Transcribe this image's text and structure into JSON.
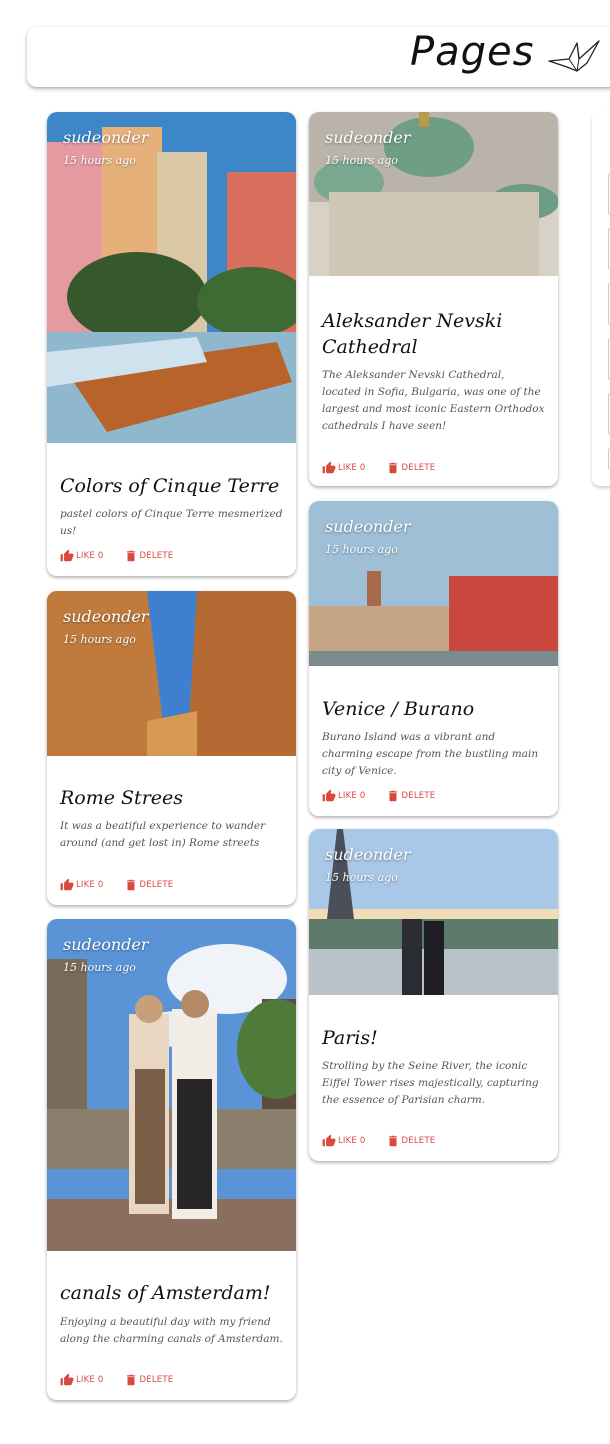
{
  "app": {
    "title": "Pages",
    "logo_icon": "paper-crane-icon"
  },
  "theme": {
    "accent": "#d84a3e",
    "title_color": "#111111",
    "text_color": "#555555"
  },
  "posts": [
    {
      "creator": "sudeonder",
      "time": "15 hours ago",
      "title": "Colors of Cinque Terre",
      "message": "pastel colors of Cinque Terre mesmerized us!",
      "like_label": "LIKE 0",
      "delete_label": "DELETE"
    },
    {
      "creator": "sudeonder",
      "time": "15 hours ago",
      "title": "Rome Strees",
      "message": "It was a beatiful experience to wander around (and get lost in) Rome streets",
      "like_label": "LIKE 0",
      "delete_label": "DELETE"
    },
    {
      "creator": "sudeonder",
      "time": "15 hours ago",
      "title": "canals of Amsterdam!",
      "message": "Enjoying a beautiful day with my friend along the charming canals of Amsterdam.",
      "like_label": "LIKE 0",
      "delete_label": "DELETE"
    },
    {
      "creator": "sudeonder",
      "time": "15 hours ago",
      "title": "Aleksander Nevski Cathedral",
      "message": "The Aleksander Nevski Cathedral, located in Sofia, Bulgaria, was one of the largest and most iconic Eastern Orthodox cathedrals I have seen!",
      "like_label": "LIKE 0",
      "delete_label": "DELETE"
    },
    {
      "creator": "sudeonder",
      "time": "15 hours ago",
      "title": "Venice / Burano",
      "message": "Burano Island was a vibrant and charming escape from the bustling main city of Venice.",
      "like_label": "LIKE 0",
      "delete_label": "DELETE"
    },
    {
      "creator": "sudeonder",
      "time": "15 hours ago",
      "title": "Paris!",
      "message": "Strolling by the Seine River, the iconic Eiffel Tower rises majestically, capturing the essence of Parisian charm.",
      "like_label": "LIKE 0",
      "delete_label": "DELETE"
    }
  ]
}
